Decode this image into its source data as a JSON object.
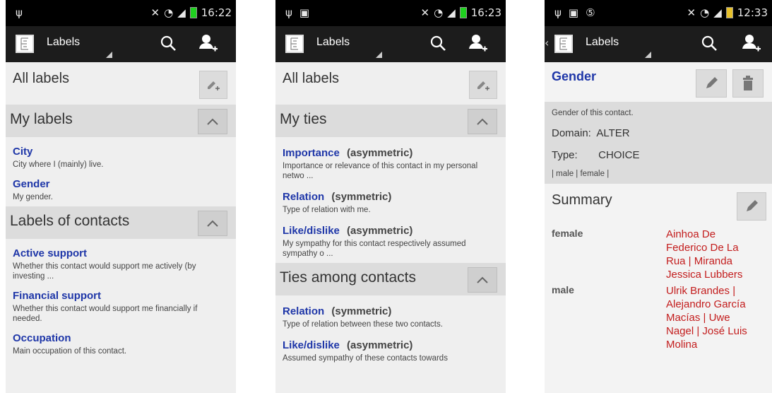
{
  "screens": [
    {
      "status": {
        "time": "16:22"
      },
      "actionbar": {
        "title": "Labels"
      },
      "heading": "All labels",
      "sections": [
        {
          "title": "My labels",
          "items": [
            {
              "title": "City",
              "desc": "City where I (mainly) live."
            },
            {
              "title": "Gender",
              "desc": "My gender."
            }
          ]
        },
        {
          "title": "Labels of contacts",
          "items": [
            {
              "title": "Active support",
              "desc": "Whether this contact would support me actively (by investing ..."
            },
            {
              "title": "Financial support",
              "desc": "Whether this contact would support me financially if needed."
            },
            {
              "title": "Occupation",
              "desc": "Main occupation of this contact."
            }
          ]
        }
      ]
    },
    {
      "status": {
        "time": "16:23"
      },
      "actionbar": {
        "title": "Labels"
      },
      "heading": "All labels",
      "sections": [
        {
          "title": "My ties",
          "items": [
            {
              "title": "Importance",
              "sub": "(asymmetric)",
              "desc": "Importance or relevance of this contact in my personal netwo ..."
            },
            {
              "title": "Relation",
              "sub": "(symmetric)",
              "desc": "Type of relation with me."
            },
            {
              "title": "Like/dislike",
              "sub": "(asymmetric)",
              "desc": "My sympathy for this contact respectively assumed sympathy o ..."
            }
          ]
        },
        {
          "title": "Ties among contacts",
          "items": [
            {
              "title": "Relation",
              "sub": "(symmetric)",
              "desc": "Type of relation between these two contacts."
            },
            {
              "title": "Like/dislike",
              "sub": "(asymmetric)",
              "desc": "Assumed sympathy of these contacts towards"
            }
          ]
        }
      ]
    },
    {
      "status": {
        "time": "12:33"
      },
      "actionbar": {
        "title": "Labels"
      },
      "heading": "Gender",
      "info": {
        "description": "Gender of this contact.",
        "domain_label": "Domain:",
        "domain_value": "ALTER",
        "type_label": "Type:",
        "type_value": "CHOICE",
        "values": "| male | female |"
      },
      "summary": {
        "title": "Summary",
        "rows": [
          {
            "key": "female",
            "value": "Ainhoa De Federico De La Rua | Miranda Jessica Lubbers"
          },
          {
            "key": "male",
            "value": "Ulrik Brandes | Alejandro García Macías | Uwe Nagel | José Luis Molina"
          }
        ]
      }
    }
  ],
  "colors": {
    "accent": "#1e36a8",
    "value_red": "#c31d1d",
    "actionbar": "#1c1c1c",
    "section_bg": "#dcdcdc"
  }
}
